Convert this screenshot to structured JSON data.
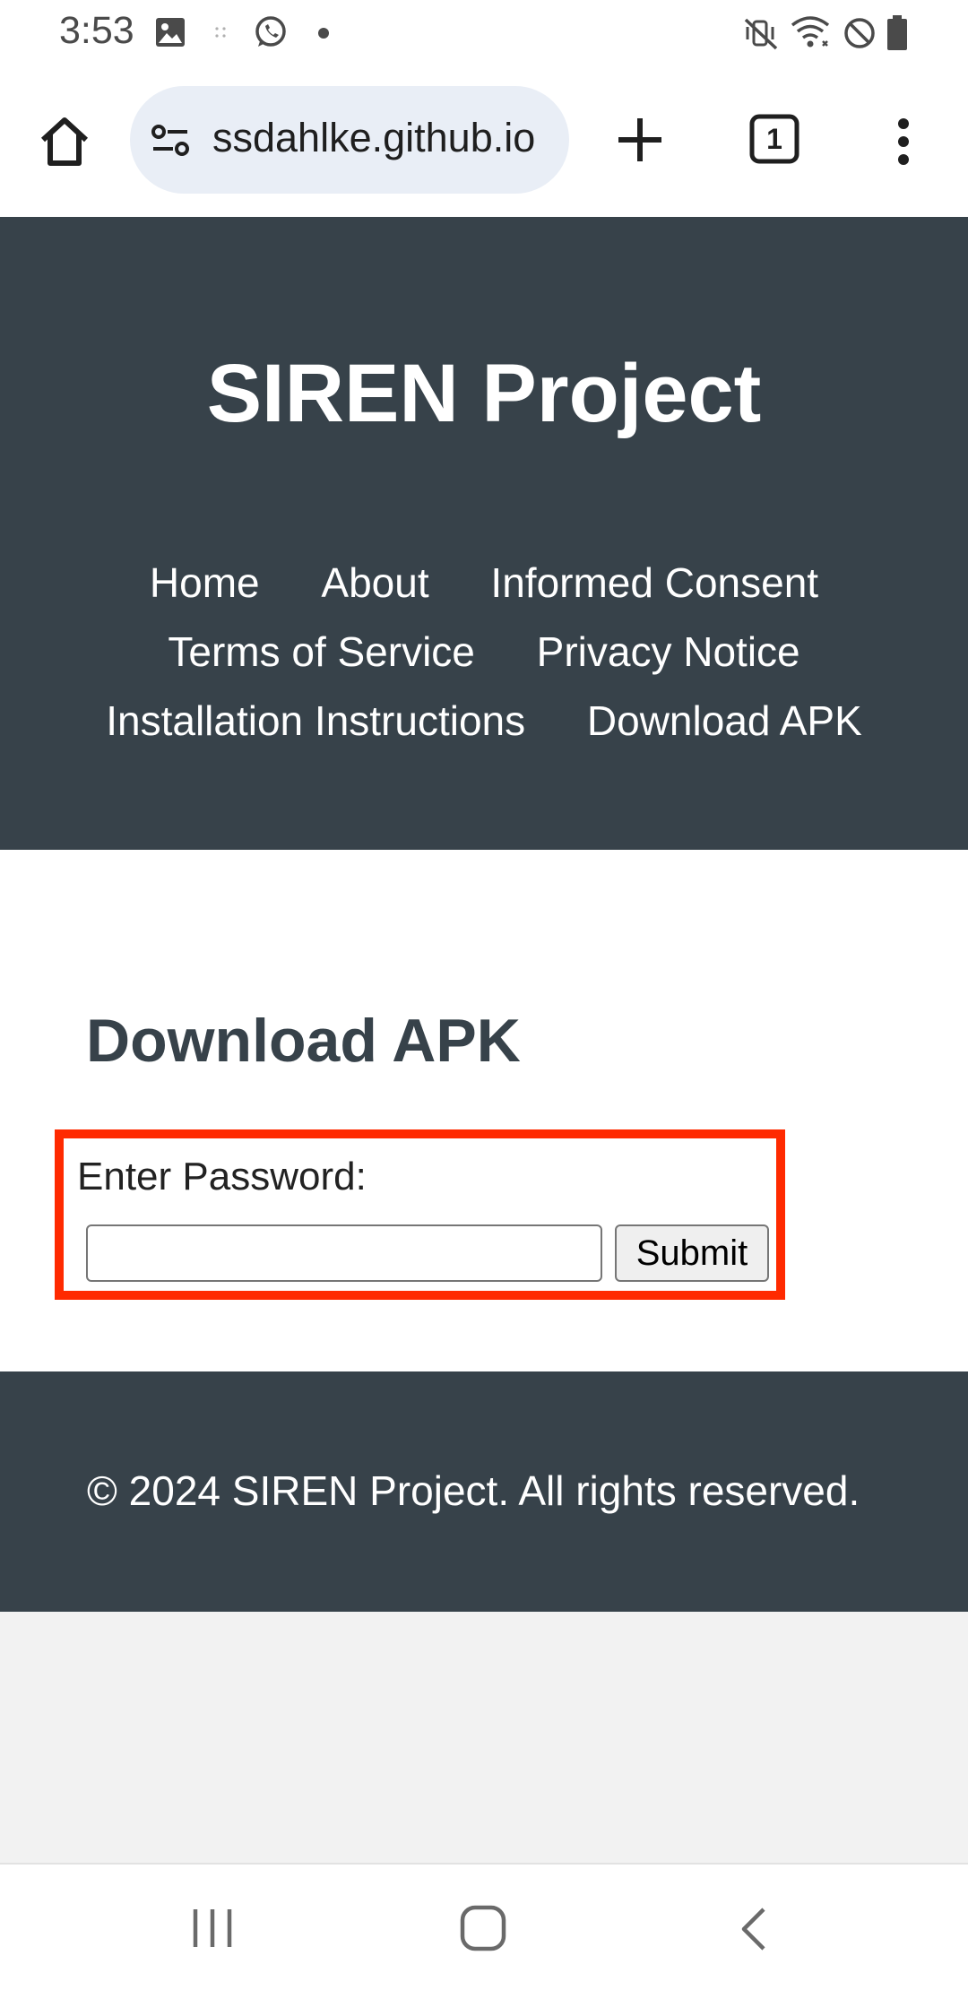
{
  "status_bar": {
    "time": "3:53",
    "left_icons": [
      "image-icon",
      "grid-dots-icon",
      "whatsapp-icon",
      "dot-icon"
    ],
    "right_icons": [
      "mute-vibrate-icon",
      "wifi-icon",
      "do-not-disturb-icon",
      "battery-icon"
    ]
  },
  "browser": {
    "url": "ssdahlke.github.io",
    "tab_count": "1",
    "icons": [
      "home-icon",
      "site-info-icon",
      "plus-icon",
      "tabs-icon",
      "more-vert-icon"
    ]
  },
  "header": {
    "title": "SIREN Project",
    "nav": [
      {
        "label": "Home"
      },
      {
        "label": "About"
      },
      {
        "label": "Informed Consent"
      },
      {
        "label": "Terms of Service"
      },
      {
        "label": "Privacy Notice"
      },
      {
        "label": "Installation Instructions"
      },
      {
        "label": "Download APK"
      }
    ]
  },
  "main": {
    "heading": "Download APK",
    "password_label": "Enter Password:",
    "password_value": "",
    "submit_label": "Submit"
  },
  "footer": {
    "text": "© 2024 SIREN Project. All rights reserved."
  },
  "colors": {
    "header_bg": "#37424a",
    "highlight_border": "#ff2a00",
    "url_pill_bg": "#e9eef6"
  }
}
